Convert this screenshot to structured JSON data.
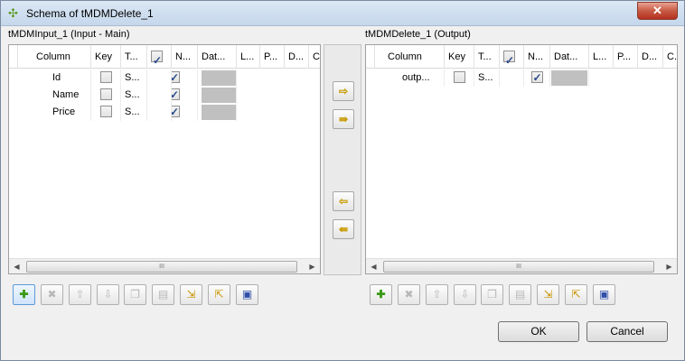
{
  "window": {
    "title": "Schema of tMDMDelete_1",
    "close_label": "✕"
  },
  "left": {
    "title": "tMDMInput_1 (Input - Main)",
    "columns": [
      "Column",
      "Key",
      "T...",
      "",
      "N...",
      "Dat...",
      "L...",
      "P...",
      "D...",
      "C..."
    ],
    "rows": [
      {
        "name": "Id",
        "key": false,
        "type": "S...",
        "nullable": true
      },
      {
        "name": "Name",
        "key": false,
        "type": "S...",
        "nullable": true
      },
      {
        "name": "Price",
        "key": false,
        "type": "S...",
        "nullable": true
      }
    ],
    "scroll_thumb": "III"
  },
  "right": {
    "title": "tMDMDelete_1 (Output)",
    "columns": [
      "Column",
      "Key",
      "T...",
      "",
      "N...",
      "Dat...",
      "L...",
      "P...",
      "D...",
      "C..."
    ],
    "rows": [
      {
        "name": "outp...",
        "key": false,
        "type": "S...",
        "nullable": true
      }
    ],
    "scroll_thumb": "III"
  },
  "transfer": {
    "copy_one_right": "⇨",
    "copy_all_right": "⇛",
    "copy_one_left": "⇦",
    "copy_all_left": "⇚"
  },
  "toolbar_icons": {
    "add": "✚",
    "remove": "✖",
    "move_up": "⇧",
    "move_down": "⇩",
    "copy": "❐",
    "paste": "▤",
    "import": "⇲",
    "export": "⇱",
    "save": "▣"
  },
  "buttons": {
    "ok": "OK",
    "cancel": "Cancel"
  }
}
